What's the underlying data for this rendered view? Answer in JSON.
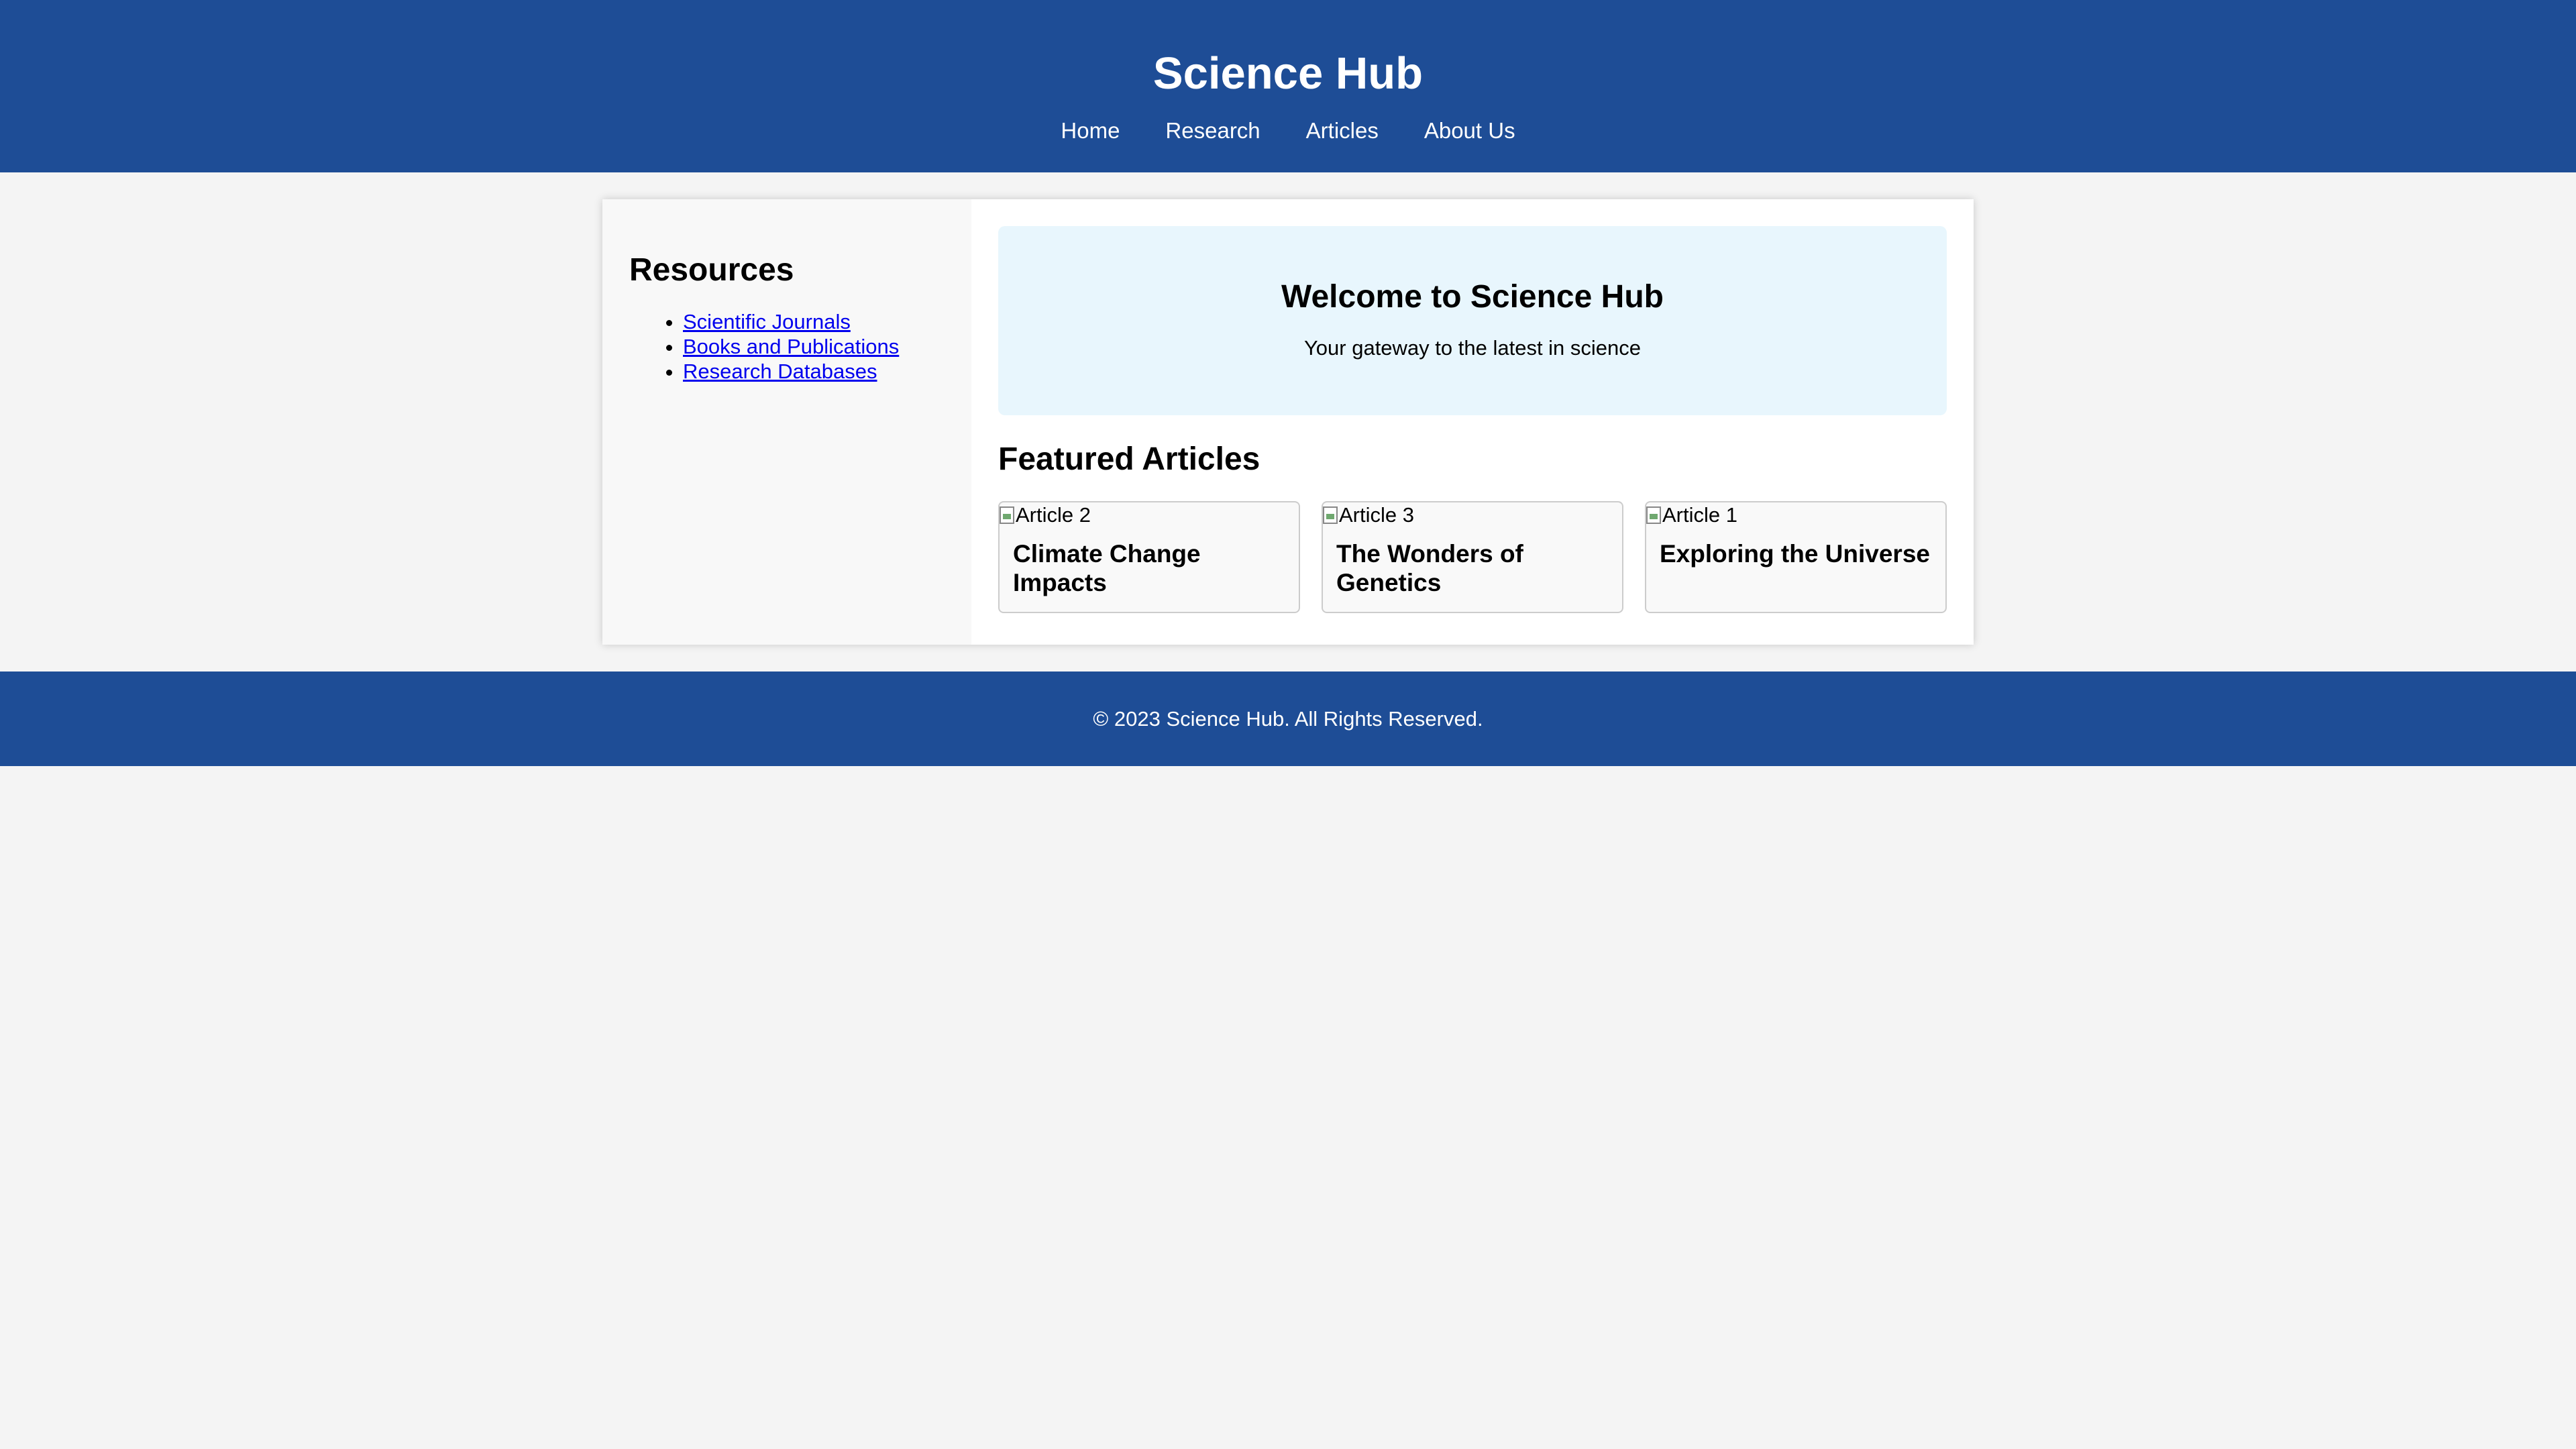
{
  "header": {
    "title": "Science Hub",
    "nav": [
      "Home",
      "Research",
      "Articles",
      "About Us"
    ]
  },
  "sidebar": {
    "heading": "Resources",
    "links": [
      "Scientific Journals",
      "Books and Publications",
      "Research Databases"
    ]
  },
  "hero": {
    "title": "Welcome to Science Hub",
    "subtitle": "Your gateway to the latest in science"
  },
  "featured": {
    "heading": "Featured Articles",
    "cards": [
      {
        "image_alt": "Article 2",
        "title": "Climate Change Impacts"
      },
      {
        "image_alt": "Article 3",
        "title": "The Wonders of Genetics"
      },
      {
        "image_alt": "Article 1",
        "title": "Exploring the Universe"
      }
    ]
  },
  "footer": {
    "text": "© 2023 Science Hub. All Rights Reserved."
  },
  "colors": {
    "brand": "#1e4d96",
    "hero_background": "#e8f6fd",
    "page_background": "#f4f4f4"
  }
}
